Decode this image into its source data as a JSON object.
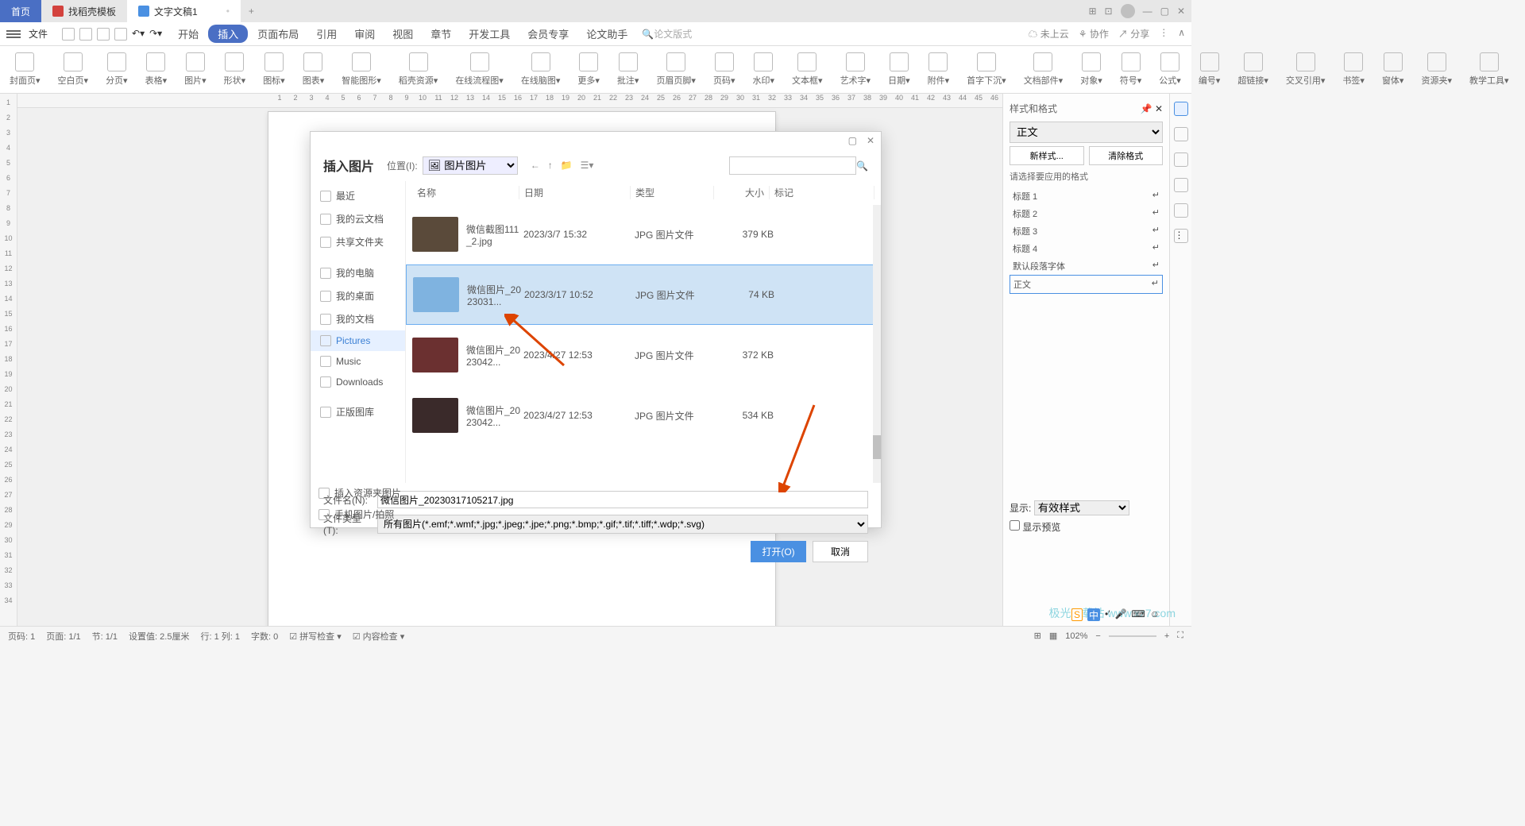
{
  "titlebar": {
    "tabs": [
      {
        "label": "首页"
      },
      {
        "label": "找稻壳模板"
      },
      {
        "label": "文字文稿1"
      }
    ],
    "add": "+"
  },
  "menubar": {
    "file": "文件",
    "items": [
      "开始",
      "插入",
      "页面布局",
      "引用",
      "审阅",
      "视图",
      "章节",
      "开发工具",
      "会员专享",
      "论文助手"
    ],
    "mode_placeholder": "论文版式",
    "right": [
      "未上云",
      "协作",
      "分享"
    ]
  },
  "ribbon": {
    "items": [
      "封面页",
      "空白页",
      "分页",
      "表格",
      "图片",
      "形状",
      "图标",
      "图表",
      "智能图形",
      "稻壳资源",
      "在线流程图",
      "在线脑图",
      "更多",
      "批注",
      "页眉页脚",
      "页码",
      "水印",
      "文本框",
      "艺术字",
      "日期",
      "附件",
      "首字下沉",
      "文档部件",
      "对象",
      "符号",
      "公式",
      "编号",
      "超链接",
      "交叉引用",
      "书签",
      "窗体",
      "资源夹",
      "教学工具"
    ]
  },
  "dialog": {
    "title": "插入图片",
    "loc_label": "位置(I):",
    "loc_value": "图片",
    "search_placeholder": "",
    "sidebar": {
      "recent": "最近",
      "cloud": "我的云文档",
      "share": "共享文件夹",
      "computer": "我的电脑",
      "desktop": "我的桌面",
      "docs": "我的文档",
      "pictures": "Pictures",
      "music": "Music",
      "downloads": "Downloads",
      "stock": "正版图库",
      "insert_res": "插入资源夹图片",
      "phone": "手机图片/拍照"
    },
    "columns": {
      "name": "名称",
      "date": "日期",
      "type": "类型",
      "size": "大小",
      "mark": "标记"
    },
    "files": [
      {
        "name": "微信截图111_2.jpg",
        "date": "2023/3/7 15:32",
        "type": "JPG 图片文件",
        "size": "379 KB"
      },
      {
        "name": "微信图片_2023031...",
        "date": "2023/3/17 10:52",
        "type": "JPG 图片文件",
        "size": "74 KB"
      },
      {
        "name": "微信图片_2023042...",
        "date": "2023/4/27 12:53",
        "type": "JPG 图片文件",
        "size": "372 KB"
      },
      {
        "name": "微信图片_2023042...",
        "date": "2023/4/27 12:53",
        "type": "JPG 图片文件",
        "size": "534 KB"
      }
    ],
    "filename_label": "文件名(N):",
    "filename_value": "微信图片_20230317105217.jpg",
    "filetype_label": "文件类型(T):",
    "filetype_value": "所有图片(*.emf;*.wmf;*.jpg;*.jpeg;*.jpe;*.png;*.bmp;*.gif;*.tif;*.tiff;*.wdp;*.svg)",
    "open": "打开(O)",
    "cancel": "取消"
  },
  "right_panel": {
    "title": "样式和格式",
    "current": "正文",
    "new": "新样式...",
    "clear": "清除格式",
    "select_label": "请选择要应用的格式",
    "styles": [
      "标题 1",
      "标题 2",
      "标题 3",
      "标题 4",
      "默认段落字体",
      "正文"
    ],
    "display_label": "显示:",
    "display_value": "有效样式",
    "preview": "显示预览"
  },
  "statusbar": {
    "left": [
      "页码: 1",
      "页面: 1/1",
      "节: 1/1",
      "设置值: 2.5厘米",
      "行: 1 列: 1",
      "字数: 0",
      "拼写检查",
      "内容检查"
    ],
    "zoom": "102%"
  },
  "rulerH": [
    1,
    2,
    3,
    4,
    5,
    6,
    7,
    8,
    9,
    10,
    11,
    12,
    13,
    14,
    15,
    16,
    17,
    18,
    19,
    20,
    21,
    22,
    23,
    24,
    25,
    26,
    27,
    28,
    29,
    30,
    31,
    32,
    33,
    34,
    35,
    36,
    37,
    38,
    39,
    40,
    41,
    42,
    43,
    44,
    45,
    46
  ],
  "rulerV": [
    1,
    2,
    3,
    4,
    5,
    6,
    7,
    8,
    9,
    10,
    11,
    12,
    13,
    14,
    15,
    16,
    17,
    18,
    19,
    20,
    21,
    22,
    23,
    24,
    25,
    26,
    27,
    28,
    29,
    30,
    31,
    32,
    33,
    34
  ],
  "watermark": "极光下载站\nwww.xz7.com"
}
